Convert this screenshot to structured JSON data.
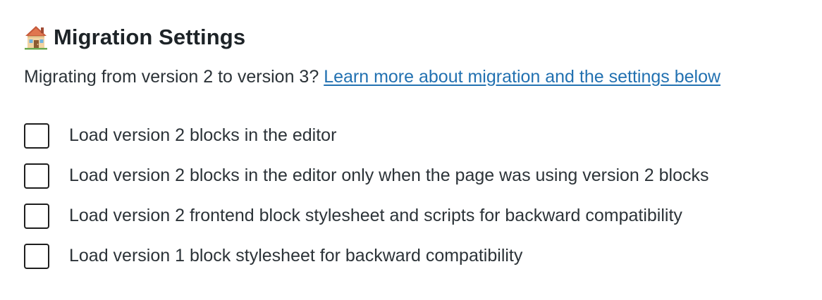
{
  "header": {
    "icon": "house-icon",
    "title": "Migration Settings"
  },
  "intro": {
    "text": "Migrating from version 2 to version 3? ",
    "link_text": "Learn more about migration and the settings below"
  },
  "options": [
    {
      "label": "Load version 2 blocks in the editor",
      "checked": false
    },
    {
      "label": "Load version 2 blocks in the editor only when the page was using version 2 blocks",
      "checked": false
    },
    {
      "label": "Load version 2 frontend block stylesheet and scripts for backward compatibility",
      "checked": false
    },
    {
      "label": "Load version 1 block stylesheet for backward compatibility",
      "checked": false
    }
  ],
  "colors": {
    "link": "#2271b1",
    "text": "#2c3338",
    "heading": "#1d2327",
    "checkbox_border": "#1e1e1e"
  }
}
